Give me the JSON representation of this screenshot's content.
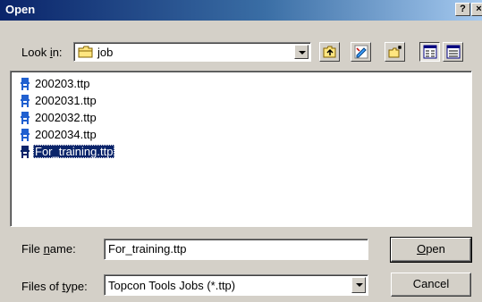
{
  "window": {
    "title": "Open",
    "help_label": "?",
    "close_label": "×"
  },
  "lookin": {
    "label_prefix": "Look ",
    "label_accel": "i",
    "label_suffix": "n:",
    "value": "job",
    "folder_icon": "folder-icon"
  },
  "toolbar": {
    "icons": [
      "up-one-level-icon",
      "desktop-icon",
      "new-folder-icon",
      "list-view-icon",
      "details-view-icon"
    ]
  },
  "files": [
    {
      "name": "200203.ttp",
      "selected": false
    },
    {
      "name": "2002031.ttp",
      "selected": false
    },
    {
      "name": "2002032.ttp",
      "selected": false
    },
    {
      "name": "2002034.ttp",
      "selected": false
    },
    {
      "name": "For_training.ttp",
      "selected": true
    }
  ],
  "filename": {
    "label_prefix": "File ",
    "label_accel": "n",
    "label_suffix": "ame:",
    "value": "For_training.ttp"
  },
  "filetype": {
    "label_prefix": "Files of ",
    "label_accel": "t",
    "label_suffix": "ype:",
    "value": "Topcon Tools Jobs (*.ttp)"
  },
  "buttons": {
    "open_accel": "O",
    "open_rest": "pen",
    "cancel": "Cancel"
  },
  "colors": {
    "title_bar": "#0a246a",
    "selection": "#0a246a",
    "face": "#d4d0c8"
  }
}
